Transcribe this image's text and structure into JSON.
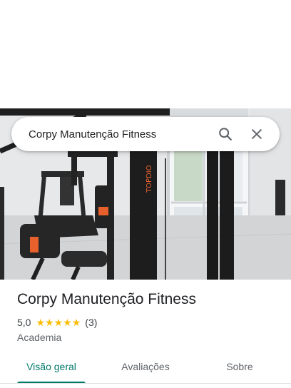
{
  "search": {
    "query": "Corpy Manutenção Fitness",
    "search_icon": "search-icon",
    "clear_icon": "close-icon"
  },
  "place": {
    "name": "Corpy Manutenção Fitness",
    "rating": "5,0",
    "stars": 5,
    "review_count": "(3)",
    "category": "Academia",
    "photo_brand_text": "TOPDIO"
  },
  "tabs": [
    {
      "label": "Visão geral",
      "active": true
    },
    {
      "label": "Avaliações",
      "active": false
    },
    {
      "label": "Sobre",
      "active": false
    }
  ],
  "colors": {
    "accent": "#00796b",
    "star": "#fbbc04"
  }
}
